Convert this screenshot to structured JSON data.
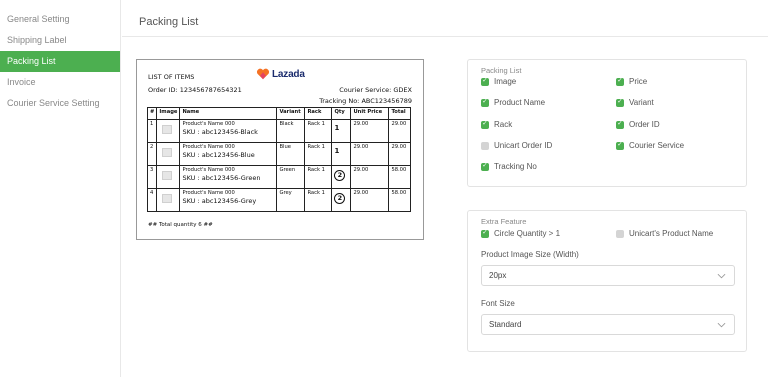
{
  "sidebar": {
    "items": [
      {
        "label": "General Setting",
        "active": false
      },
      {
        "label": "Shipping Label",
        "active": false
      },
      {
        "label": "Packing List",
        "active": true
      },
      {
        "label": "Invoice",
        "active": false
      },
      {
        "label": "Courier Service Setting",
        "active": false
      }
    ]
  },
  "page": {
    "title": "Packing List"
  },
  "preview": {
    "list_title": "LIST OF ITEMS",
    "brand": "Lazada",
    "order_id": "Order ID: 123456787654321",
    "courier": "Courier Service: GDEX",
    "tracking": "Tracking No: ABC123456789",
    "columns": [
      "#",
      "Image",
      "Name",
      "Variant",
      "Rack",
      "Qty",
      "Unit Price",
      "Total"
    ],
    "rows": [
      {
        "no": "1",
        "name": "Product's Name 000",
        "sku": "SKU : abc123456-Black",
        "variant": "Black",
        "rack": "Rack 1",
        "qty": "1",
        "circled": false,
        "price": "29.00",
        "total": "29.00"
      },
      {
        "no": "2",
        "name": "Product's Name 000",
        "sku": "SKU : abc123456-Blue",
        "variant": "Blue",
        "rack": "Rack 1",
        "qty": "1",
        "circled": false,
        "price": "29.00",
        "total": "29.00"
      },
      {
        "no": "3",
        "name": "Product's Name 000",
        "sku": "SKU : abc123456-Green",
        "variant": "Green",
        "rack": "Rack 1",
        "qty": "2",
        "circled": true,
        "price": "29.00",
        "total": "58.00"
      },
      {
        "no": "4",
        "name": "Product's Name 000",
        "sku": "SKU : abc123456-Grey",
        "variant": "Grey",
        "rack": "Rack 1",
        "qty": "2",
        "circled": true,
        "price": "29.00",
        "total": "58.00"
      }
    ],
    "total_quantity": "## Total quantity 6 ##"
  },
  "packing_list_options": {
    "title": "Packing List",
    "options": [
      {
        "label": "Image",
        "checked": true
      },
      {
        "label": "Price",
        "checked": true
      },
      {
        "label": "Product Name",
        "checked": true
      },
      {
        "label": "Variant",
        "checked": true
      },
      {
        "label": "Rack",
        "checked": true
      },
      {
        "label": "Order ID",
        "checked": true
      },
      {
        "label": "Unicart Order ID",
        "checked": false
      },
      {
        "label": "Courier Service",
        "checked": true
      },
      {
        "label": "Tracking No",
        "checked": true
      }
    ]
  },
  "extra_feature": {
    "title": "Extra Feature",
    "options": [
      {
        "label": "Circle Quantity > 1",
        "checked": true
      },
      {
        "label": "Unicart's Product Name",
        "checked": false
      }
    ],
    "image_size": {
      "label": "Product Image Size (Width)",
      "value": "20px"
    },
    "font_size": {
      "label": "Font Size",
      "value": "Standard"
    }
  },
  "colors": {
    "accent": "#4caf50",
    "unchecked": "#d4d4d4",
    "brand_heart": "#f57224"
  }
}
